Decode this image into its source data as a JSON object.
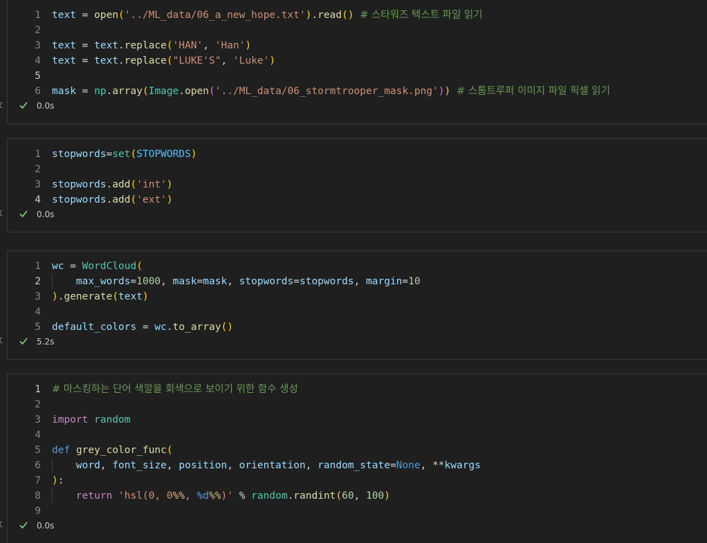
{
  "cells": [
    {
      "lines": [
        {
          "num": "1",
          "tokens": [
            [
              "v",
              "text"
            ],
            [
              "op",
              " = "
            ],
            [
              "f",
              "open"
            ],
            [
              "b1",
              "("
            ],
            [
              "s",
              "'../ML_data/06_a_new_hope.txt'"
            ],
            [
              "b1",
              ")"
            ],
            [
              "op",
              "."
            ],
            [
              "f",
              "read"
            ],
            [
              "b1",
              "()"
            ],
            [
              "op",
              " "
            ],
            [
              "c",
              "# 스타워즈 텍스트 파일 읽기"
            ]
          ]
        },
        {
          "num": "2",
          "tokens": []
        },
        {
          "num": "3",
          "tokens": [
            [
              "v",
              "text"
            ],
            [
              "op",
              " = "
            ],
            [
              "v",
              "text"
            ],
            [
              "op",
              "."
            ],
            [
              "f",
              "replace"
            ],
            [
              "b1",
              "("
            ],
            [
              "s",
              "'HAN'"
            ],
            [
              "op",
              ", "
            ],
            [
              "s",
              "'Han'"
            ],
            [
              "b1",
              ")"
            ]
          ]
        },
        {
          "num": "4",
          "tokens": [
            [
              "v",
              "text"
            ],
            [
              "op",
              " = "
            ],
            [
              "v",
              "text"
            ],
            [
              "op",
              "."
            ],
            [
              "f",
              "replace"
            ],
            [
              "b1",
              "("
            ],
            [
              "s",
              "\"LUKE'S\""
            ],
            [
              "op",
              ", "
            ],
            [
              "s",
              "'Luke'"
            ],
            [
              "b1",
              ")"
            ]
          ]
        },
        {
          "num": "5",
          "tokens": [],
          "active": true
        },
        {
          "num": "6",
          "tokens": [
            [
              "v",
              "mask"
            ],
            [
              "op",
              " = "
            ],
            [
              "cls",
              "np"
            ],
            [
              "op",
              "."
            ],
            [
              "f",
              "array"
            ],
            [
              "b1",
              "("
            ],
            [
              "cls",
              "Image"
            ],
            [
              "op",
              "."
            ],
            [
              "f",
              "open"
            ],
            [
              "b2",
              "("
            ],
            [
              "s",
              "'../ML_data/06_stormtrooper_mask.png'"
            ],
            [
              "b2",
              ")"
            ],
            [
              "b1",
              ")"
            ],
            [
              "op",
              " "
            ],
            [
              "c",
              "# 스톰트루퍼 이미지 파일 픽셀 읽기"
            ]
          ]
        }
      ],
      "time": "0.0s"
    },
    {
      "lines": [
        {
          "num": "1",
          "tokens": [
            [
              "v",
              "stopwords"
            ],
            [
              "op",
              "="
            ],
            [
              "cls",
              "set"
            ],
            [
              "b1",
              "("
            ],
            [
              "const",
              "STOPWORDS"
            ],
            [
              "b1",
              ")"
            ]
          ]
        },
        {
          "num": "2",
          "tokens": []
        },
        {
          "num": "3",
          "tokens": [
            [
              "v",
              "stopwords"
            ],
            [
              "op",
              "."
            ],
            [
              "f",
              "add"
            ],
            [
              "b1",
              "("
            ],
            [
              "s",
              "'int'"
            ],
            [
              "b1",
              ")"
            ]
          ]
        },
        {
          "num": "4",
          "tokens": [
            [
              "v",
              "stopwords"
            ],
            [
              "op",
              "."
            ],
            [
              "f",
              "add"
            ],
            [
              "b1",
              "("
            ],
            [
              "s",
              "'ext'"
            ],
            [
              "b1",
              ")"
            ]
          ],
          "active": true
        }
      ],
      "time": "0.0s"
    },
    {
      "lines": [
        {
          "num": "1",
          "tokens": [
            [
              "v",
              "wc"
            ],
            [
              "op",
              " = "
            ],
            [
              "cls",
              "WordCloud"
            ],
            [
              "b1",
              "("
            ]
          ]
        },
        {
          "num": "2",
          "tokens": [
            [
              "op",
              "    "
            ],
            [
              "v",
              "max_words"
            ],
            [
              "op",
              "="
            ],
            [
              "n",
              "1000"
            ],
            [
              "op",
              ", "
            ],
            [
              "v",
              "mask"
            ],
            [
              "op",
              "="
            ],
            [
              "v",
              "mask"
            ],
            [
              "op",
              ", "
            ],
            [
              "v",
              "stopwords"
            ],
            [
              "op",
              "="
            ],
            [
              "v",
              "stopwords"
            ],
            [
              "op",
              ", "
            ],
            [
              "v",
              "margin"
            ],
            [
              "op",
              "="
            ],
            [
              "n",
              "10"
            ]
          ],
          "active": true,
          "guide": true
        },
        {
          "num": "3",
          "tokens": [
            [
              "b1",
              ")"
            ],
            [
              "op",
              "."
            ],
            [
              "f",
              "generate"
            ],
            [
              "b1",
              "("
            ],
            [
              "v",
              "text"
            ],
            [
              "b1",
              ")"
            ]
          ]
        },
        {
          "num": "4",
          "tokens": []
        },
        {
          "num": "5",
          "tokens": [
            [
              "v",
              "default_colors"
            ],
            [
              "op",
              " = "
            ],
            [
              "v",
              "wc"
            ],
            [
              "op",
              "."
            ],
            [
              "f",
              "to_array"
            ],
            [
              "b1",
              "()"
            ]
          ]
        }
      ],
      "time": "5.2s"
    },
    {
      "lines": [
        {
          "num": "1",
          "tokens": [
            [
              "c",
              "# 마스킹하는 단어 색깔을 회색으로 보이기 위한 함수 생성"
            ]
          ],
          "active": true
        },
        {
          "num": "2",
          "tokens": []
        },
        {
          "num": "3",
          "tokens": [
            [
              "k",
              "import"
            ],
            [
              "op",
              " "
            ],
            [
              "cls",
              "random"
            ]
          ]
        },
        {
          "num": "4",
          "tokens": []
        },
        {
          "num": "5",
          "tokens": [
            [
              "kb",
              "def"
            ],
            [
              "op",
              " "
            ],
            [
              "f",
              "grey_color_func"
            ],
            [
              "b1",
              "("
            ]
          ]
        },
        {
          "num": "6",
          "tokens": [
            [
              "op",
              "    "
            ],
            [
              "v",
              "word"
            ],
            [
              "op",
              ", "
            ],
            [
              "v",
              "font_size"
            ],
            [
              "op",
              ", "
            ],
            [
              "v",
              "position"
            ],
            [
              "op",
              ", "
            ],
            [
              "v",
              "orientation"
            ],
            [
              "op",
              ", "
            ],
            [
              "v",
              "random_state"
            ],
            [
              "op",
              "="
            ],
            [
              "kb",
              "None"
            ],
            [
              "op",
              ", **"
            ],
            [
              "v",
              "kwargs"
            ]
          ],
          "guide": true
        },
        {
          "num": "7",
          "tokens": [
            [
              "b1",
              ")"
            ],
            [
              "op",
              ":"
            ]
          ]
        },
        {
          "num": "8",
          "tokens": [
            [
              "op",
              "    "
            ],
            [
              "k",
              "return"
            ],
            [
              "op",
              " "
            ],
            [
              "s",
              "'hsl(0, 0"
            ],
            [
              "esc",
              "%%"
            ],
            [
              "s",
              ", "
            ],
            [
              "kb",
              "%d"
            ],
            [
              "esc",
              "%%"
            ],
            [
              "s",
              ")'"
            ],
            [
              "op",
              " % "
            ],
            [
              "cls",
              "random"
            ],
            [
              "op",
              "."
            ],
            [
              "f",
              "randint"
            ],
            [
              "b1",
              "("
            ],
            [
              "n",
              "60"
            ],
            [
              "op",
              ", "
            ],
            [
              "n",
              "100"
            ],
            [
              "b1",
              ")"
            ]
          ],
          "guide": true
        },
        {
          "num": "9",
          "tokens": []
        }
      ],
      "time": "0.0s"
    }
  ]
}
